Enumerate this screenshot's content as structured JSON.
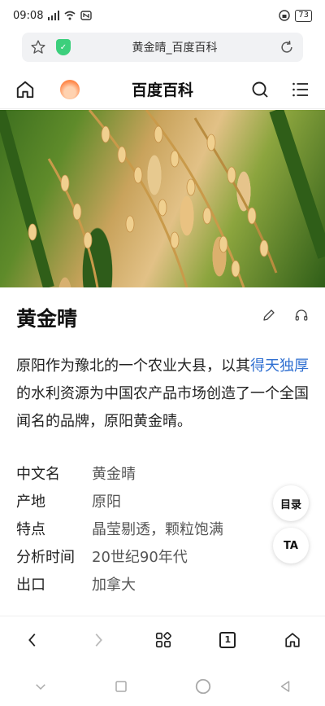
{
  "status_bar": {
    "time": "09:08",
    "battery": "73"
  },
  "url_bar": {
    "title": "黄金晴_百度百科"
  },
  "header": {
    "title": "百度百科"
  },
  "entry": {
    "title": "黄金晴",
    "summary_before": "原阳作为豫北的一个农业大县，以其",
    "summary_link": "得天独厚",
    "summary_after": "的水利资源为中国农产品市场创造了一个全国闻名的品牌，原阳黄金晴。"
  },
  "info": [
    {
      "key": "中文名",
      "value": "黄金晴"
    },
    {
      "key": "产地",
      "value": "原阳"
    },
    {
      "key": "特点",
      "value": "晶莹剔透，颗粒饱满"
    },
    {
      "key": "分析时间",
      "value": "20世纪90年代"
    },
    {
      "key": "出口",
      "value": "加拿大"
    }
  ],
  "floating": {
    "toc_label": "目录",
    "ta_label": "TA"
  },
  "bottom_nav": {
    "tab_count": "1"
  },
  "icons": {
    "star": "star-icon",
    "shield": "shield-icon",
    "refresh": "refresh-icon",
    "home": "home-icon",
    "flame": "flame-icon",
    "search": "search-icon",
    "menu": "menu-icon",
    "edit": "pencil-icon",
    "audio": "headphones-icon"
  },
  "colors": {
    "link": "#2f6fd1",
    "shield": "#3ccf7c"
  }
}
